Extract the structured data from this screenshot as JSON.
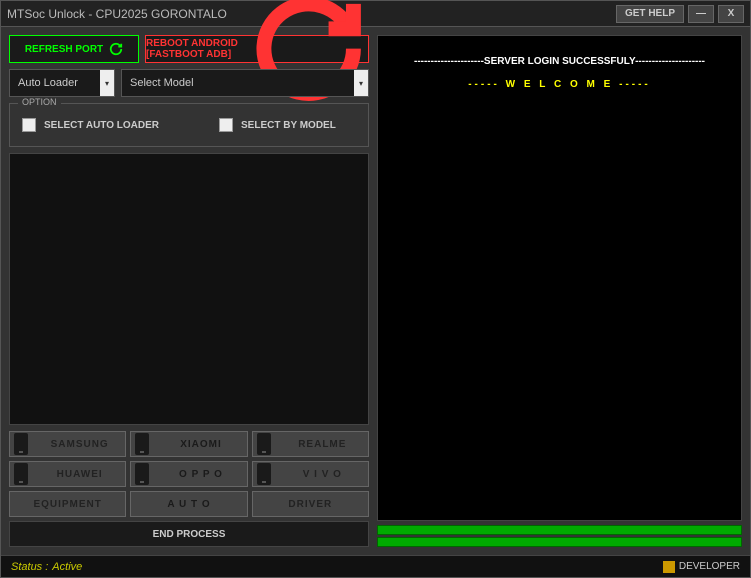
{
  "title": "MTSoc Unlock  -  CPU2025 GORONTALO",
  "header": {
    "gethelp": "GET HELP",
    "minimize": "—",
    "close": "X"
  },
  "toolbar": {
    "refresh": "REFRESH PORT",
    "reboot": "REBOOT ANDROID [FASTBOOT ADB]"
  },
  "selects": {
    "loader": "Auto Loader",
    "model": "Select Model"
  },
  "option": {
    "legend": "OPTION",
    "auto_loader": "SELECT AUTO LOADER",
    "by_model": "SELECT BY MODEL"
  },
  "brands": {
    "samsung": "SAMSUNG",
    "xiaomi": "XIAOMI",
    "realme": "REALME",
    "huawei": "HUAWEI",
    "oppo": "O P P O",
    "vivo": "V I V O",
    "equipment": "EQUIPMENT",
    "auto": "A U T O",
    "driver": "DRIVER"
  },
  "end_process": "END PROCESS",
  "console": {
    "login": "SERVER LOGIN SUCCESSFULY",
    "welcome": "----- W E L C O M E -----"
  },
  "status": {
    "label": "Status  :",
    "value": "Active",
    "developer": "DEVELOPER"
  }
}
